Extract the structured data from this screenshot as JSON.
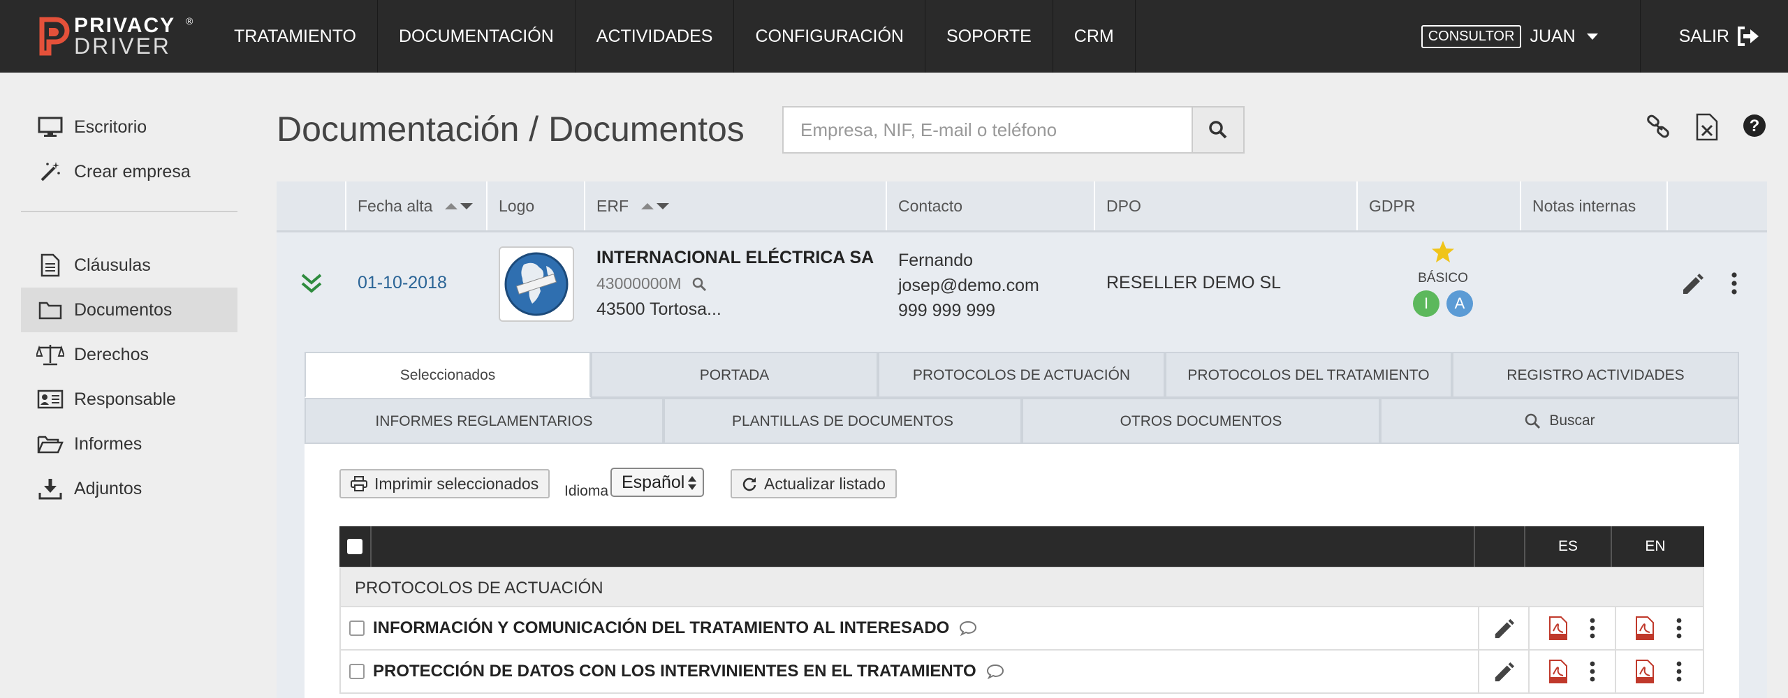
{
  "brand": {
    "line1": "PRIVACY",
    "line2": "DRIVER",
    "reg": "®"
  },
  "nav": [
    "TRATAMIENTO",
    "DOCUMENTACIÓN",
    "ACTIVIDADES",
    "CONFIGURACIÓN",
    "SOPORTE",
    "CRM"
  ],
  "user": {
    "role": "CONSULTOR",
    "name": "JUAN",
    "logout": "SALIR"
  },
  "sidebar": {
    "top": [
      {
        "label": "Escritorio",
        "icon": "monitor-icon"
      },
      {
        "label": "Crear empresa",
        "icon": "magic-wand-icon"
      }
    ],
    "items": [
      {
        "label": "Cláusulas",
        "icon": "document-icon"
      },
      {
        "label": "Documentos",
        "icon": "folder-icon",
        "active": true
      },
      {
        "label": "Derechos",
        "icon": "balance-scale-icon"
      },
      {
        "label": "Responsable",
        "icon": "id-card-icon"
      },
      {
        "label": "Informes",
        "icon": "folder-open-icon"
      },
      {
        "label": "Adjuntos",
        "icon": "download-icon"
      }
    ]
  },
  "page": {
    "title": "Documentación / Documentos",
    "search_placeholder": "Empresa, NIF, E-mail o teléfono"
  },
  "table": {
    "columns": [
      "Fecha alta",
      "Logo",
      "ERF",
      "Contacto",
      "DPO",
      "GDPR",
      "Notas internas"
    ]
  },
  "company": {
    "date": "01-10-2018",
    "name": "INTERNACIONAL ELÉCTRICA SA",
    "nif": "43000000M",
    "city": "43500 Tortosa...",
    "contact_name": "Fernando",
    "contact_email": "josep@demo.com",
    "contact_phone": "999 999 999",
    "dpo": "RESELLER DEMO SL",
    "gdpr_level": "BÁSICO",
    "badge_i": "I",
    "badge_a": "A",
    "colors": {
      "badge_i": "#5cb85c",
      "badge_a": "#5b9bd5",
      "star": "#f0c419"
    }
  },
  "tabs": {
    "row1": [
      "Seleccionados",
      "PORTADA",
      "PROTOCOLOS DE ACTUACIÓN",
      "PROTOCOLOS DEL TRATAMIENTO",
      "REGISTRO ACTIVIDADES"
    ],
    "row2": [
      "INFORMES REGLAMENTARIOS",
      "PLANTILLAS DE DOCUMENTOS",
      "OTROS DOCUMENTOS",
      "Buscar"
    ]
  },
  "toolbar": {
    "print": "Imprimir seleccionados",
    "idioma": "Idioma",
    "language": "Español",
    "refresh": "Actualizar listado"
  },
  "docs": {
    "col_es": "ES",
    "col_en": "EN",
    "section": "PROTOCOLOS DE ACTUACIÓN",
    "rows": [
      "INFORMACIÓN Y COMUNICACIÓN DEL TRATAMIENTO AL INTERESADO",
      "PROTECCIÓN DE DATOS CON LOS INTERVINIENTES EN EL TRATAMIENTO"
    ]
  }
}
